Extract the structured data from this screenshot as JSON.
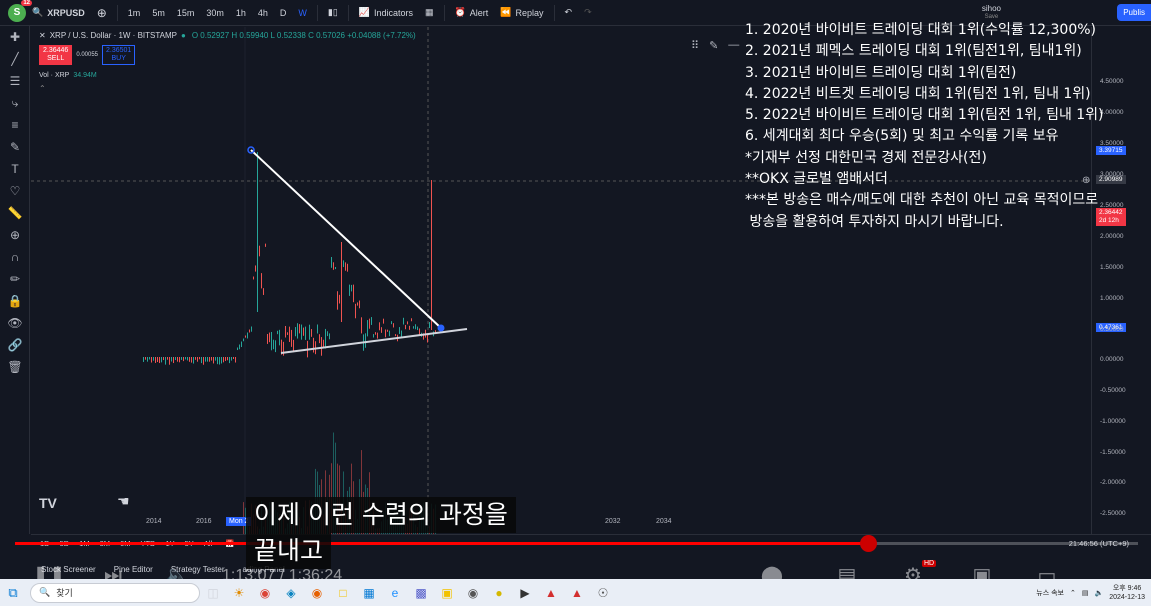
{
  "topbar": {
    "avatar_letter": "S",
    "avatar_badge": "12",
    "symbol": "XRPUSD",
    "intervals": [
      "1m",
      "5m",
      "15m",
      "30m",
      "1h",
      "4h",
      "D",
      "W"
    ],
    "active_interval": "W",
    "indicators_label": "Indicators",
    "alert_label": "Alert",
    "replay_label": "Replay",
    "user_name": "sihoo",
    "user_status": "Save",
    "publish_label": "Publis"
  },
  "legend": {
    "title": "XRP / U.S. Dollar · 1W · BITSTAMP",
    "ohlc": "O 0.52927  H 0.59940  L 0.52338  C 0.57026  +0.04088 (+7.72%)",
    "sell_price": "2.36446",
    "sell_label": "SELL",
    "spread": "0.00055",
    "buy_price": "2.36501",
    "buy_label": "BUY",
    "vol_label": "Vol · XRP",
    "vol_value": "34.94M"
  },
  "price_axis": {
    "ticks": [
      "4.50000",
      "4.00000",
      "3.50000",
      "3.00000",
      "2.50000",
      "2.00000",
      "1.50000",
      "1.00000",
      "0.50000",
      "0.00000",
      "-0.50000",
      "-1.00000",
      "-1.50000",
      "-2.00000",
      "-2.50000"
    ],
    "label_high": "3.39715",
    "label_cross": "2.90989",
    "label_current": "2.36442",
    "label_countdown": "2d 12h",
    "label_low": "0.47361",
    "colors": {
      "high": "#2962ff",
      "cross": "#363a45",
      "current": "#f23645",
      "low": "#2962ff"
    }
  },
  "time_axis": {
    "years": [
      "2014",
      "2016",
      "Mon 2",
      "2032",
      "2034"
    ],
    "highlight_year": "Mon 2"
  },
  "range_bar": {
    "ranges": [
      "1D",
      "5D",
      "1M",
      "3M",
      "6M",
      "YTD",
      "1Y",
      "5Y",
      "All"
    ],
    "clock": "21:46:56 (UTC+9)"
  },
  "bottom_panels": [
    "Stock Screener",
    "Pine Editor",
    "Strategy Tester",
    "ading Panel"
  ],
  "overlay_lines": [
    "1. 2020년 바이비트 트레이딩 대회 1위(수익률 12,300%)",
    "2. 2021년 페멕스 트레이딩 대회 1위(팀전1위, 팀내1위)",
    "3. 2021년 바이비트 트레이딩 대회 1위(팀전)",
    "4. 2022년 비트겟 트레이딩 대회 1위(팀전 1위, 팀내 1위)",
    "5. 2022년 바이비트 트레이딩 대회 1위(팀전 1위, 팀내 1위)",
    "6. 세계대회 최다 우승(5회) 및 최고 수익률 기록 보유",
    "*기재부 선정 대한민국 경제 전문강사(전)",
    "**OKX 글로벌 앰배서더",
    "***본 방송은 매수/매도에 대한 추천이 아닌 교육 목적이므로",
    " 방송을 활용하여 투자하지 마시기 바랍니다."
  ],
  "video": {
    "subtitle_line1": "이제 이런 수렴의 과정을",
    "subtitle_line2": "끝내고",
    "current_time": "1:13:07",
    "duration": "1:36:24",
    "progress": 0.76,
    "hd_badge": "HD",
    "accent": "#ff0000"
  },
  "taskbar": {
    "search_placeholder": "찾기",
    "tray_news": "뉴스 속보",
    "clock_time": "오후 9:46",
    "clock_date": "2024-12-13"
  }
}
